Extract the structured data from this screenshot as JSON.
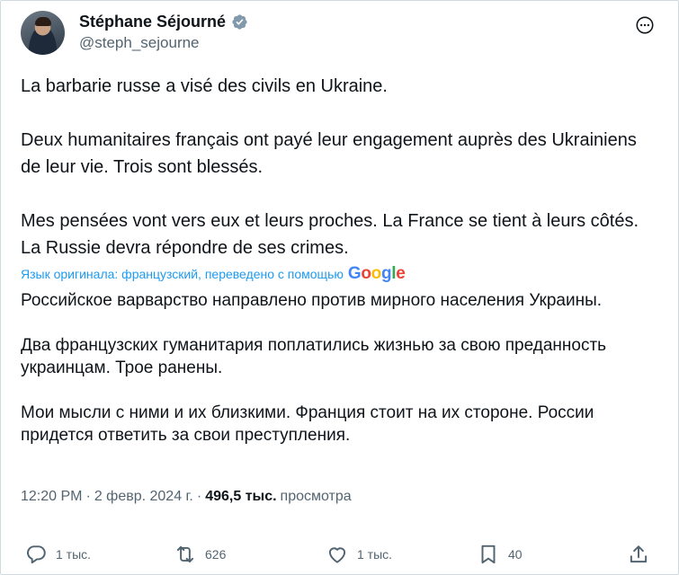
{
  "author": {
    "name": "Stéphane Séjourné",
    "handle": "@steph_sejourne"
  },
  "original_text": "La barbarie russe a visé des civils en Ukraine.\n\nDeux humanitaires français ont payé leur engagement auprès des Ukrainiens de leur vie. Trois sont blessés.\n\nMes pensées vont vers eux et leurs proches. La France se tient à leurs côtés. La Russie devra répondre de ses crimes.",
  "translation_notice": "Язык оригинала: французский, переведено с помощью",
  "translation_provider": "Google",
  "translated_text": "Российское варварство направлено против мирного населения Украины.\n\nДва французских гуманитария поплатились жизнью за свою преданность украинцам. Трое ранены.\n\nМои мысли с ними и их близкими. Франция стоит на их стороне. России придется ответить за свои преступления.",
  "meta": {
    "time": "12:20 PM",
    "separator": "·",
    "date": "2 февр. 2024 г.",
    "views_count": "496,5 тыс.",
    "views_label": "просмотра"
  },
  "actions": {
    "replies": "1 тыс.",
    "reposts": "626",
    "likes": "1 тыс.",
    "bookmarks": "40"
  },
  "colors": {
    "accent": "#1d9bf0",
    "text": "#0f1419",
    "muted": "#536471",
    "border": "#cfd9de"
  },
  "icons": [
    "verified-badge-icon",
    "more-icon",
    "reply-icon",
    "repost-icon",
    "like-icon",
    "bookmark-icon",
    "share-icon"
  ]
}
